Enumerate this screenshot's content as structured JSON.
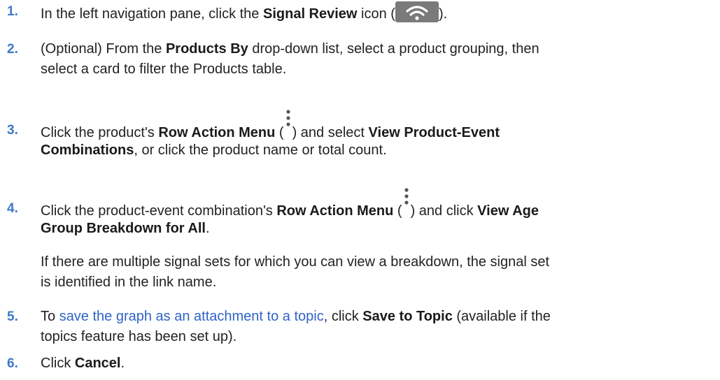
{
  "steps": [
    {
      "num": "1.",
      "t1": "In the left navigation pane, click the ",
      "b1": "Signal Review",
      "t2": " icon (",
      "t3": ")."
    },
    {
      "num": "2.",
      "t1": "(Optional) From the ",
      "b1": "Products By",
      "t2": " drop-down list, select a product grouping, then",
      "line2": "select a card to filter the Products table."
    },
    {
      "num": "3.",
      "t1": "Click the product's ",
      "b1": "Row Action Menu",
      "t2": " (",
      "t3": ") and select ",
      "b2": "View Product-Event",
      "b3": "Combinations",
      "t4": ", or click the product name or total count."
    },
    {
      "num": "4.",
      "t1": "Click the product-event combination's ",
      "b1": "Row Action Menu",
      "t2": " (",
      "t3": ") and click ",
      "b2": "View Age",
      "b3": "Group Breakdown for All",
      "t4": ".",
      "note1": "If there are multiple signal sets for which you can view a breakdown, the signal set",
      "note2": "is identified in the link name."
    },
    {
      "num": "5.",
      "t1": "To ",
      "link": "save the graph as an attachment to a topic",
      "t2": ", click ",
      "b1": "Save to Topic",
      "t3": " (available if the",
      "line2": "topics feature has been set up)."
    },
    {
      "num": "6.",
      "t1": "Click ",
      "b1": "Cancel",
      "t2": "."
    }
  ],
  "icons": {
    "signal_review": "wifi-signal-icon",
    "row_action": "kebab-menu-icon"
  },
  "colors": {
    "step_number": "#3d79c4",
    "link": "#2f63c7",
    "icon_background": "#7a7a7a"
  }
}
